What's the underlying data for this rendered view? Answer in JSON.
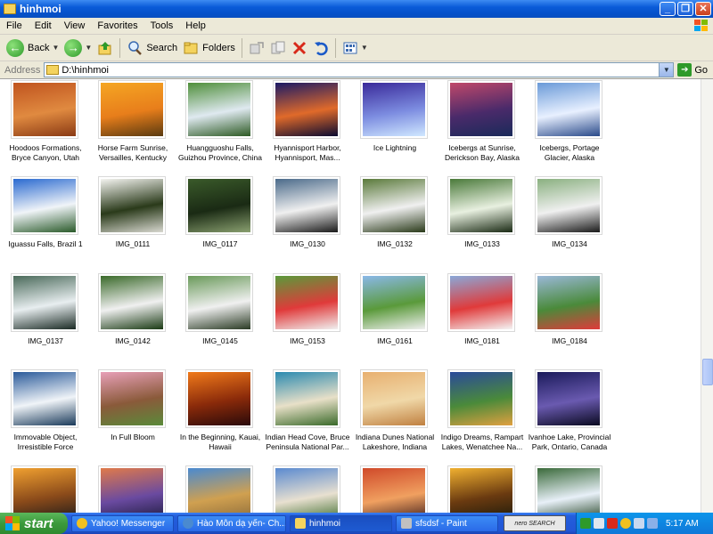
{
  "window": {
    "title": "hinhmoi"
  },
  "menu": [
    "File",
    "Edit",
    "View",
    "Favorites",
    "Tools",
    "Help"
  ],
  "toolbar": {
    "back_label": "Back",
    "search_label": "Search",
    "folders_label": "Folders"
  },
  "address": {
    "label": "Address",
    "value": "D:\\hinhmoi",
    "go_label": "Go"
  },
  "files": [
    {
      "name": "Hoodoos Formations, Bryce Canyon, Utah",
      "colors": [
        "#c0541f",
        "#e08a40",
        "#8a3a14"
      ]
    },
    {
      "name": "Horse Farm Sunrise, Versailles, Kentucky",
      "colors": [
        "#f5a623",
        "#e87e1b",
        "#5a3a10"
      ]
    },
    {
      "name": "Huangguoshu Falls, Guizhou Province, China",
      "colors": [
        "#4f8f3a",
        "#dfe9f0",
        "#2d5a24"
      ]
    },
    {
      "name": "Hyannisport Harbor, Hyannisport, Mas...",
      "colors": [
        "#1a1a66",
        "#e06a2a",
        "#0a0a30"
      ]
    },
    {
      "name": "Ice Lightning",
      "colors": [
        "#3a2a9a",
        "#7c8ce0",
        "#d0e8ff"
      ]
    },
    {
      "name": "Icebergs at Sunrise, Derickson Bay, Alaska",
      "colors": [
        "#c0486a",
        "#4a2a6a",
        "#1a2a5a"
      ]
    },
    {
      "name": "Icebergs, Portage Glacier, Alaska",
      "colors": [
        "#6a9ad8",
        "#e8f0ff",
        "#2a4a8a"
      ]
    },
    {
      "name": "Iguassu Falls, Brazil 1",
      "colors": [
        "#2a6ad0",
        "#f0f4f8",
        "#2a5a2a"
      ]
    },
    {
      "name": "IMG_0111",
      "colors": [
        "#f4f4f0",
        "#2a3a1a",
        "#d8d8d0"
      ]
    },
    {
      "name": "IMG_0117",
      "colors": [
        "#3a5a2a",
        "#1a2a14",
        "#8aa070"
      ]
    },
    {
      "name": "IMG_0130",
      "colors": [
        "#4a6a8a",
        "#f0f0f0",
        "#1a1a1a"
      ]
    },
    {
      "name": "IMG_0132",
      "colors": [
        "#5a7a3a",
        "#f0f0f0",
        "#2a3a1a"
      ]
    },
    {
      "name": "IMG_0133",
      "colors": [
        "#4a7a3a",
        "#e8f0e0",
        "#1a2a14"
      ]
    },
    {
      "name": "IMG_0134",
      "colors": [
        "#8ab080",
        "#f0f0f0",
        "#1a1a1a"
      ]
    },
    {
      "name": "IMG_0137",
      "colors": [
        "#4a6a5a",
        "#e8eef0",
        "#1a2a24"
      ]
    },
    {
      "name": "IMG_0142",
      "colors": [
        "#3a6a2a",
        "#f0f0f0",
        "#1a3a14"
      ]
    },
    {
      "name": "IMG_0145",
      "colors": [
        "#6a9a5a",
        "#f0f0f0",
        "#2a3a24"
      ]
    },
    {
      "name": "IMG_0153",
      "colors": [
        "#5a9a3a",
        "#e03a3a",
        "#f0f0f0"
      ]
    },
    {
      "name": "IMG_0161",
      "colors": [
        "#8ab8e8",
        "#5a9a3a",
        "#f0f0f0"
      ]
    },
    {
      "name": "IMG_0181",
      "colors": [
        "#8aa8d8",
        "#e03a3a",
        "#f4f4f4"
      ]
    },
    {
      "name": "IMG_0184",
      "colors": [
        "#9ab8d8",
        "#4a8a3a",
        "#e03a3a"
      ]
    },
    {
      "name": "Immovable Object, Irresistible Force",
      "colors": [
        "#2a5a9a",
        "#f0f4f8",
        "#1a3a5a"
      ]
    },
    {
      "name": "In Full Bloom",
      "colors": [
        "#e8a0b8",
        "#8a5a3a",
        "#5a8a3a"
      ]
    },
    {
      "name": "In the Beginning, Kauai, Hawaii",
      "colors": [
        "#f07a1a",
        "#8a2a0a",
        "#2a0a0a"
      ]
    },
    {
      "name": "Indian Head Cove, Bruce Peninsula National Par...",
      "colors": [
        "#2a8ab0",
        "#e8e0c8",
        "#3a6a2a"
      ]
    },
    {
      "name": "Indiana Dunes National Lakeshore, Indiana",
      "colors": [
        "#e8b070",
        "#f0d8a8",
        "#c08040"
      ]
    },
    {
      "name": "Indigo Dreams, Rampart Lakes, Wenatchee Na...",
      "colors": [
        "#2a4a9a",
        "#4a8a3a",
        "#e0a040"
      ]
    },
    {
      "name": "Ivanhoe Lake, Provincial Park, Ontario, Canada",
      "colors": [
        "#1a1a5a",
        "#6a5ab0",
        "#0a0a20"
      ]
    },
    {
      "name": "",
      "colors": [
        "#f0a030",
        "#8a4a1a",
        "#1a1a1a"
      ]
    },
    {
      "name": "",
      "colors": [
        "#e07a4a",
        "#6a4aa0",
        "#1a1a3a"
      ]
    },
    {
      "name": "",
      "colors": [
        "#4a8ad0",
        "#d0a050",
        "#8a6a3a"
      ]
    },
    {
      "name": "",
      "colors": [
        "#5a8ad0",
        "#e8e0d0",
        "#3a6a2a"
      ]
    },
    {
      "name": "",
      "colors": [
        "#d04a2a",
        "#f0a060",
        "#3a1a1a"
      ]
    },
    {
      "name": "",
      "colors": [
        "#f0b030",
        "#6a3a10",
        "#1a1a0a"
      ]
    },
    {
      "name": "",
      "colors": [
        "#3a6a3a",
        "#e8f0f8",
        "#1a3a1a"
      ]
    }
  ],
  "taskbar": {
    "start_label": "start",
    "tasks": [
      {
        "label": "Yahoo! Messenger",
        "color": "#f0c020"
      },
      {
        "label": "Hào Môn dạ yến- Ch...",
        "color": "#4a8ad0"
      },
      {
        "label": "hinhmoi",
        "color": "#f4d35e"
      },
      {
        "label": "sfsdsf - Paint",
        "color": "#c0c0c0"
      }
    ],
    "nero_label": "nero SEARCH",
    "clock": "5:17 AM"
  }
}
